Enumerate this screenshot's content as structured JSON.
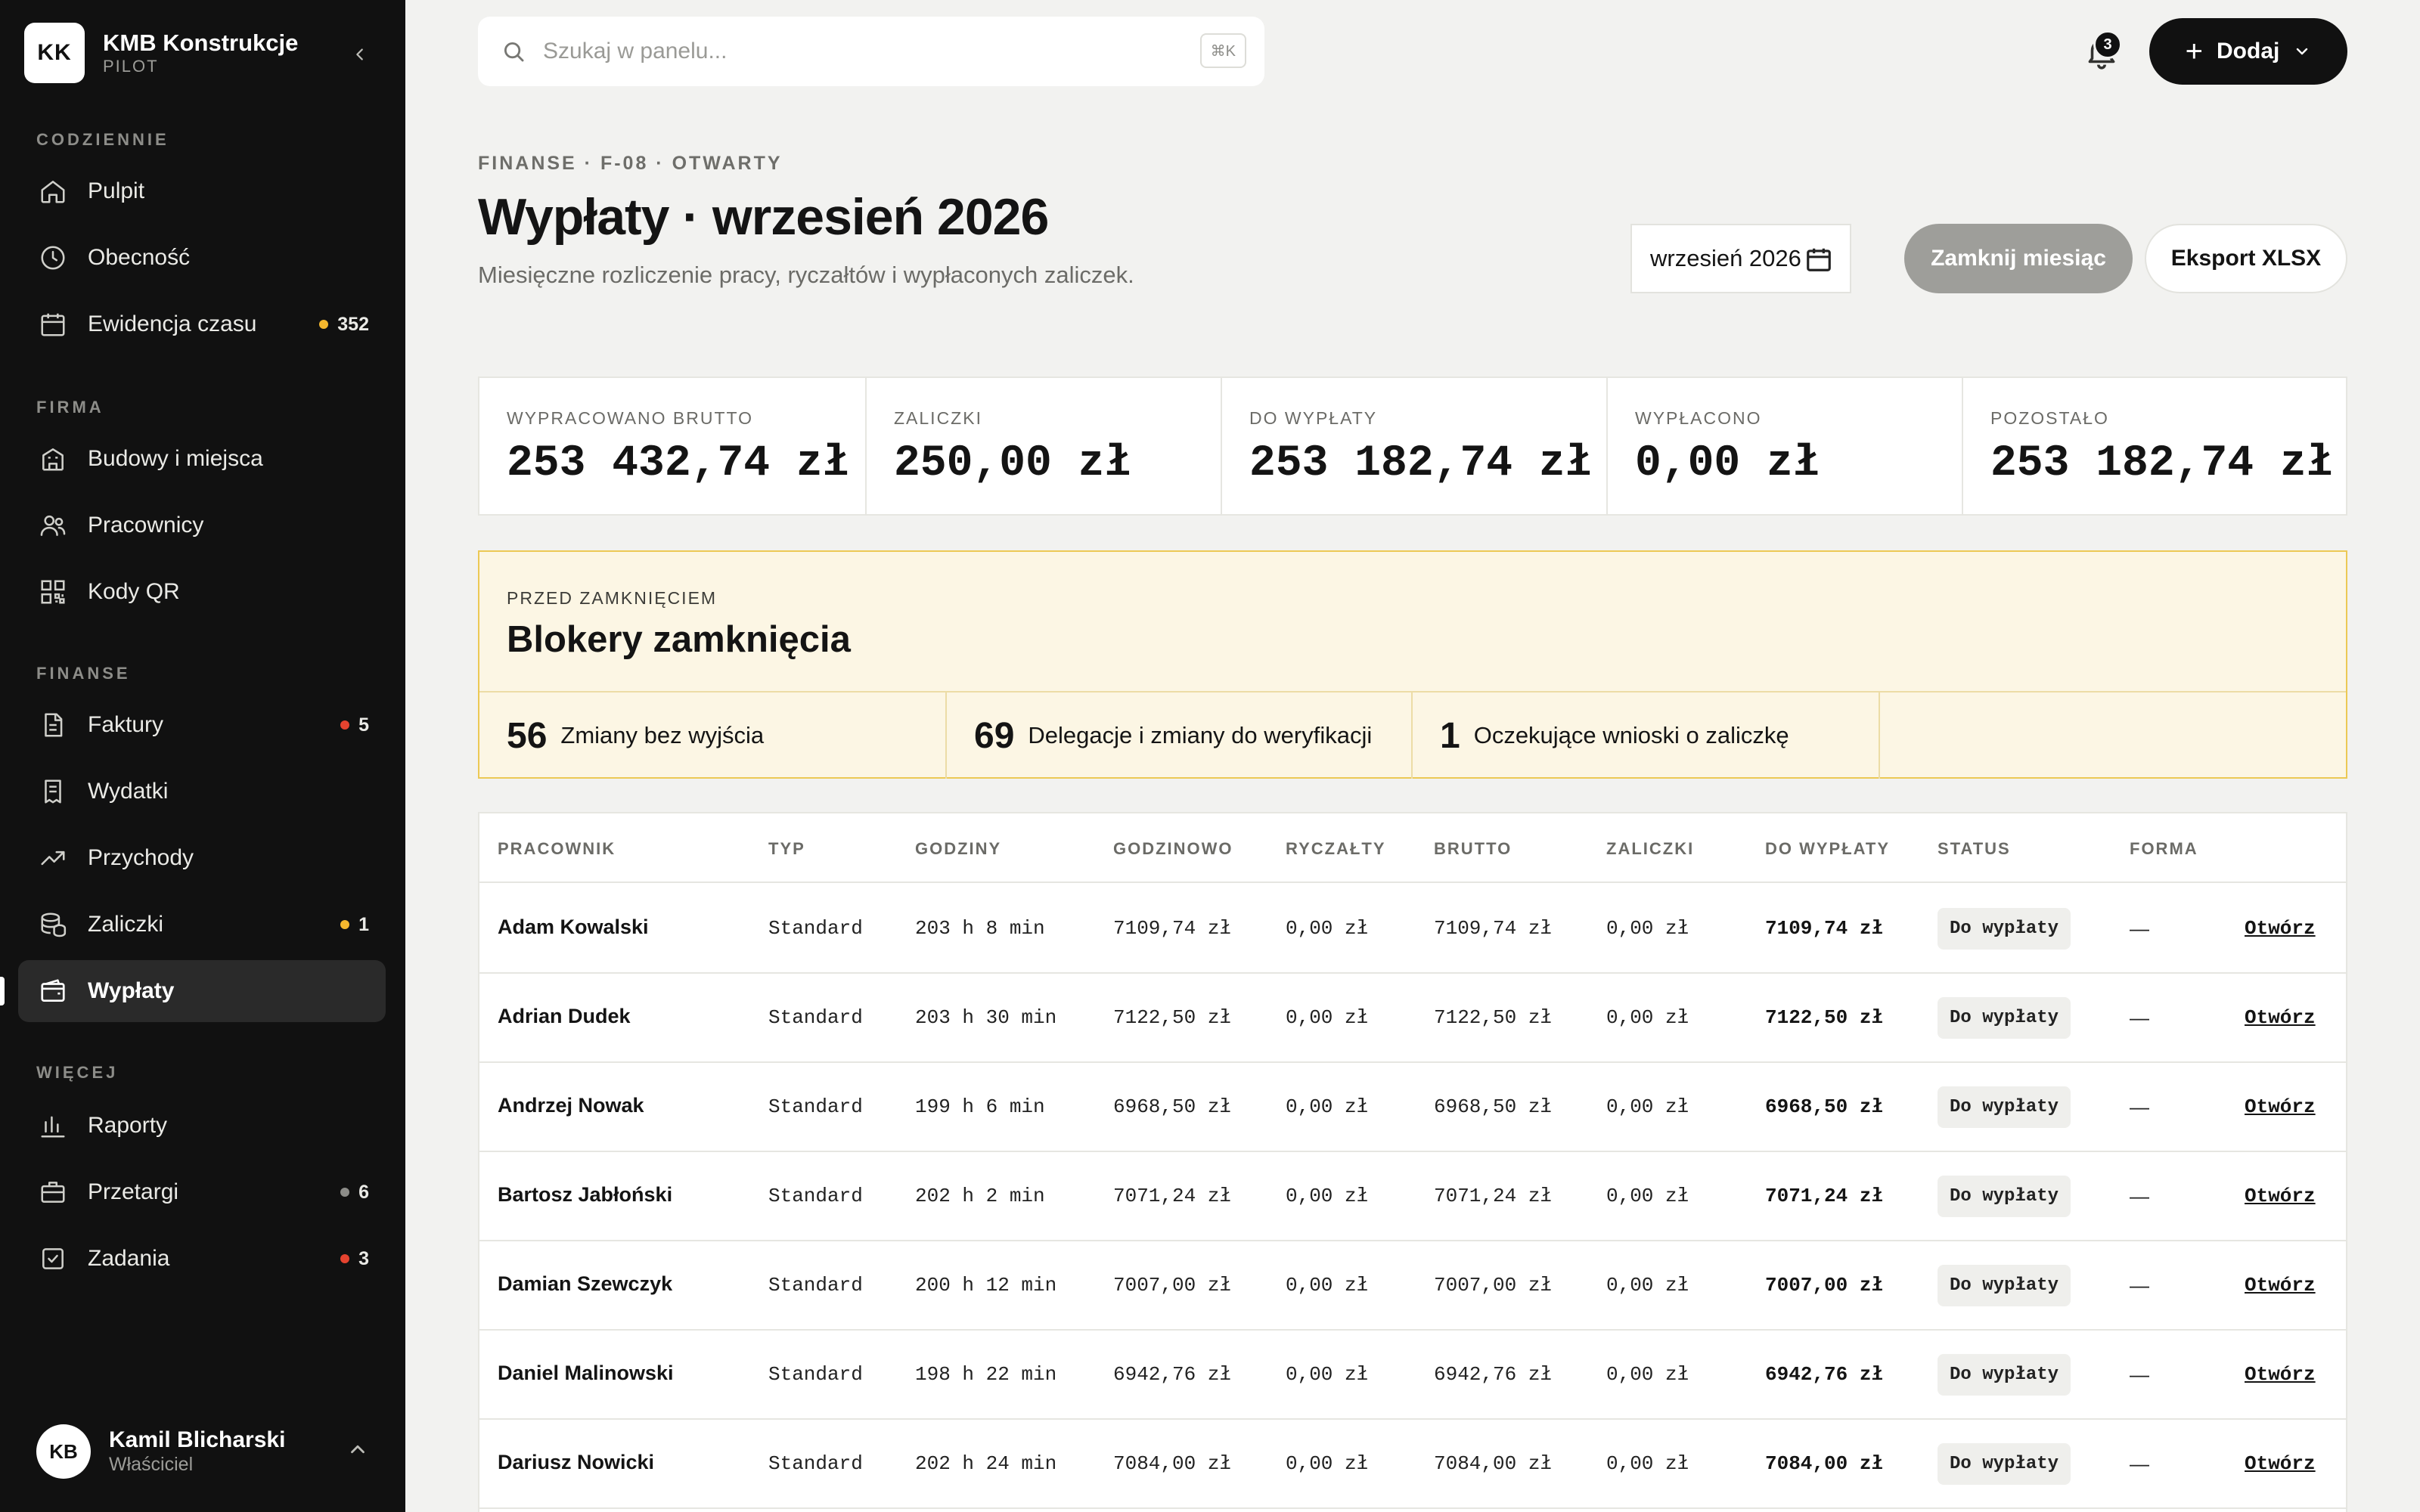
{
  "brand": {
    "initials": "KK",
    "name": "KMB Konstrukcje",
    "plan": "PILOT"
  },
  "sidebar": {
    "sections": [
      {
        "title": "CODZIENNIE",
        "items": [
          {
            "label": "Pulpit",
            "icon": "home-icon"
          },
          {
            "label": "Obecność",
            "icon": "clock-icon"
          },
          {
            "label": "Ewidencja czasu",
            "icon": "calendar-icon",
            "badge": "352",
            "badge_color": "#f5b82e"
          }
        ]
      },
      {
        "title": "FIRMA",
        "items": [
          {
            "label": "Budowy i miejsca",
            "icon": "building-icon"
          },
          {
            "label": "Pracownicy",
            "icon": "users-icon"
          },
          {
            "label": "Kody QR",
            "icon": "qr-icon"
          }
        ]
      },
      {
        "title": "FINANSE",
        "items": [
          {
            "label": "Faktury",
            "icon": "invoice-icon",
            "badge": "5",
            "badge_color": "#e5432f"
          },
          {
            "label": "Wydatki",
            "icon": "receipt-icon"
          },
          {
            "label": "Przychody",
            "icon": "trend-icon"
          },
          {
            "label": "Zaliczki",
            "icon": "coins-icon",
            "badge": "1",
            "badge_color": "#f5b82e"
          },
          {
            "label": "Wypłaty",
            "icon": "wallet-icon",
            "active": true
          }
        ]
      },
      {
        "title": "WIĘCEJ",
        "items": [
          {
            "label": "Raporty",
            "icon": "bar-chart-icon"
          },
          {
            "label": "Przetargi",
            "icon": "briefcase-icon",
            "badge": "6",
            "badge_color": "#8d8d89"
          },
          {
            "label": "Zadania",
            "icon": "checkbox-icon",
            "badge": "3",
            "badge_color": "#e5432f"
          }
        ]
      }
    ]
  },
  "user": {
    "initials": "KB",
    "name": "Kamil Blicharski",
    "role": "Właściciel"
  },
  "topbar": {
    "search_placeholder": "Szukaj w panelu...",
    "shortcut": "⌘K",
    "notifications": "3",
    "add_label": "Dodaj"
  },
  "page": {
    "breadcrumb": "FINANSE · F-08 · OTWARTY",
    "title": "Wypłaty · wrzesień 2026",
    "subtitle": "Miesięczne rozliczenie pracy, ryczałtów i wypłaconych zaliczek.",
    "month_value": "wrzesień 2026",
    "close_month_label": "Zamknij miesiąc",
    "export_label": "Eksport XLSX"
  },
  "stats": [
    {
      "label": "WYPRACOWANO BRUTTO",
      "value": "253 432,74 zł"
    },
    {
      "label": "ZALICZKI",
      "value": "250,00 zł"
    },
    {
      "label": "DO WYPŁATY",
      "value": "253 182,74 zł"
    },
    {
      "label": "WYPŁACONO",
      "value": "0,00 zł"
    },
    {
      "label": "POZOSTAŁO",
      "value": "253 182,74 zł"
    }
  ],
  "blockers": {
    "kicker": "PRZED ZAMKNIĘCIEM",
    "title": "Blokery zamknięcia",
    "items": [
      {
        "count": "56",
        "label": "Zmiany bez wyjścia"
      },
      {
        "count": "69",
        "label": "Delegacje i zmiany do weryfikacji"
      },
      {
        "count": "1",
        "label": "Oczekujące wnioski o zaliczkę"
      }
    ]
  },
  "table": {
    "columns": [
      "PRACOWNIK",
      "TYP",
      "GODZINY",
      "GODZINOWO",
      "RYCZAŁTY",
      "BRUTTO",
      "ZALICZKI",
      "DO WYPŁATY",
      "STATUS",
      "FORMA"
    ],
    "action_label": "Otwórz",
    "rows": [
      {
        "name": "Adam Kowalski",
        "type": "Standard",
        "hours": "203 h 8 min",
        "hourly": "7109,74 zł",
        "lump": "0,00 zł",
        "gross": "7109,74 zł",
        "advances": "0,00 zł",
        "payout": "7109,74 zł",
        "status": "Do wypłaty",
        "form": "—"
      },
      {
        "name": "Adrian Dudek",
        "type": "Standard",
        "hours": "203 h 30 min",
        "hourly": "7122,50 zł",
        "lump": "0,00 zł",
        "gross": "7122,50 zł",
        "advances": "0,00 zł",
        "payout": "7122,50 zł",
        "status": "Do wypłaty",
        "form": "—"
      },
      {
        "name": "Andrzej Nowak",
        "type": "Standard",
        "hours": "199 h 6 min",
        "hourly": "6968,50 zł",
        "lump": "0,00 zł",
        "gross": "6968,50 zł",
        "advances": "0,00 zł",
        "payout": "6968,50 zł",
        "status": "Do wypłaty",
        "form": "—"
      },
      {
        "name": "Bartosz Jabłoński",
        "type": "Standard",
        "hours": "202 h 2 min",
        "hourly": "7071,24 zł",
        "lump": "0,00 zł",
        "gross": "7071,24 zł",
        "advances": "0,00 zł",
        "payout": "7071,24 zł",
        "status": "Do wypłaty",
        "form": "—"
      },
      {
        "name": "Damian Szewczyk",
        "type": "Standard",
        "hours": "200 h 12 min",
        "hourly": "7007,00 zł",
        "lump": "0,00 zł",
        "gross": "7007,00 zł",
        "advances": "0,00 zł",
        "payout": "7007,00 zł",
        "status": "Do wypłaty",
        "form": "—"
      },
      {
        "name": "Daniel Malinowski",
        "type": "Standard",
        "hours": "198 h 22 min",
        "hourly": "6942,76 zł",
        "lump": "0,00 zł",
        "gross": "6942,76 zł",
        "advances": "0,00 zł",
        "payout": "6942,76 zł",
        "status": "Do wypłaty",
        "form": "—"
      },
      {
        "name": "Dariusz Nowicki",
        "type": "Standard",
        "hours": "202 h 24 min",
        "hourly": "7084,00 zł",
        "lump": "0,00 zł",
        "gross": "7084,00 zł",
        "advances": "0,00 zł",
        "payout": "7084,00 zł",
        "status": "Do wypłaty",
        "form": "—"
      }
    ]
  }
}
